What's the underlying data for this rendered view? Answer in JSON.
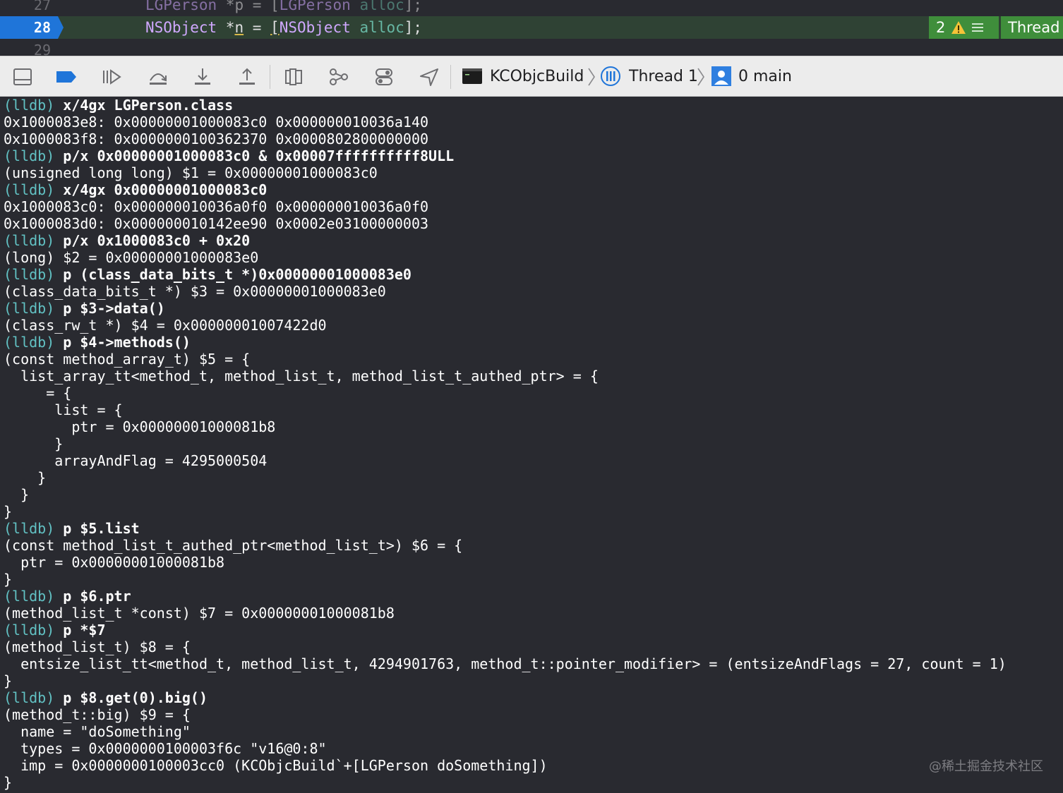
{
  "editor": {
    "lines": [
      {
        "number": "27",
        "code": "LGPerson *p = [LGPerson alloc];"
      },
      {
        "number": "28",
        "code": "NSObject *n = [NSObject alloc];"
      },
      {
        "number": "29",
        "code": ""
      }
    ],
    "issue_count": "2",
    "thread_tag": "Thread"
  },
  "debug_bar": {
    "buttons": [
      {
        "name": "hide-debug-area",
        "icon": "panel-bottom-icon"
      },
      {
        "name": "breakpoints-toggle",
        "icon": "breakpoint-icon",
        "color": "#1f75d9"
      },
      {
        "name": "continue",
        "icon": "continue-icon"
      },
      {
        "name": "step-over",
        "icon": "step-over-icon"
      },
      {
        "name": "step-into",
        "icon": "step-into-icon"
      },
      {
        "name": "step-out",
        "icon": "step-out-icon"
      },
      {
        "name": "debug-view-hierarchy",
        "icon": "view-hierarchy-icon"
      },
      {
        "name": "memory-graph",
        "icon": "memory-graph-icon"
      },
      {
        "name": "environment-overrides",
        "icon": "toggles-icon"
      },
      {
        "name": "simulate-location",
        "icon": "location-arrow-icon"
      }
    ],
    "breadcrumb": {
      "target": "KCObjcBuild",
      "thread": "Thread 1",
      "frame": "0 main"
    }
  },
  "console": {
    "prompt": "(lldb)",
    "lines": [
      {
        "type": "cmd",
        "text": "x/4gx LGPerson.class"
      },
      {
        "type": "out",
        "text": "0x1000083e8: 0x00000001000083c0 0x000000010036a140"
      },
      {
        "type": "out",
        "text": "0x1000083f8: 0x0000000100362370 0x0000802800000000"
      },
      {
        "type": "cmd",
        "text": "p/x 0x00000001000083c0 & 0x00007ffffffffff8ULL"
      },
      {
        "type": "out",
        "text": "(unsigned long long) $1 = 0x00000001000083c0"
      },
      {
        "type": "cmd",
        "text": "x/4gx 0x00000001000083c0"
      },
      {
        "type": "out",
        "text": "0x1000083c0: 0x000000010036a0f0 0x000000010036a0f0"
      },
      {
        "type": "out",
        "text": "0x1000083d0: 0x000000010142ee90 0x0002e03100000003"
      },
      {
        "type": "cmd",
        "text": "p/x 0x1000083c0 + 0x20"
      },
      {
        "type": "out",
        "text": "(long) $2 = 0x00000001000083e0"
      },
      {
        "type": "cmd",
        "text": "p (class_data_bits_t *)0x00000001000083e0"
      },
      {
        "type": "out",
        "text": "(class_data_bits_t *) $3 = 0x00000001000083e0"
      },
      {
        "type": "cmd",
        "text": "p $3->data()"
      },
      {
        "type": "out",
        "text": "(class_rw_t *) $4 = 0x00000001007422d0"
      },
      {
        "type": "cmd",
        "text": "p $4->methods()"
      },
      {
        "type": "out",
        "text": "(const method_array_t) $5 = {"
      },
      {
        "type": "out",
        "text": "  list_array_tt<method_t, method_list_t, method_list_t_authed_ptr> = {"
      },
      {
        "type": "out",
        "text": "     = {"
      },
      {
        "type": "out",
        "text": "      list = {"
      },
      {
        "type": "out",
        "text": "        ptr = 0x00000001000081b8"
      },
      {
        "type": "out",
        "text": "      }"
      },
      {
        "type": "out",
        "text": "      arrayAndFlag = 4295000504"
      },
      {
        "type": "out",
        "text": "    }"
      },
      {
        "type": "out",
        "text": "  }"
      },
      {
        "type": "out",
        "text": "}"
      },
      {
        "type": "cmd",
        "text": "p $5.list"
      },
      {
        "type": "out",
        "text": "(const method_list_t_authed_ptr<method_list_t>) $6 = {"
      },
      {
        "type": "out",
        "text": "  ptr = 0x00000001000081b8"
      },
      {
        "type": "out",
        "text": "}"
      },
      {
        "type": "cmd",
        "text": "p $6.ptr"
      },
      {
        "type": "out",
        "text": "(method_list_t *const) $7 = 0x00000001000081b8"
      },
      {
        "type": "cmd",
        "text": "p *$7"
      },
      {
        "type": "out",
        "text": "(method_list_t) $8 = {"
      },
      {
        "type": "out",
        "text": "  entsize_list_tt<method_t, method_list_t, 4294901763, method_t::pointer_modifier> = (entsizeAndFlags = 27, count = 1)"
      },
      {
        "type": "out",
        "text": "}"
      },
      {
        "type": "cmd",
        "text": "p $8.get(0).big()"
      },
      {
        "type": "out",
        "text": "(method_t::big) $9 = {"
      },
      {
        "type": "out",
        "text": "  name = \"doSomething\""
      },
      {
        "type": "out",
        "text": "  types = 0x0000000100003f6c \"v16@0:8\""
      },
      {
        "type": "out",
        "text": "  imp = 0x0000000100003cc0 (KCObjcBuild`+[LGPerson doSomething])"
      },
      {
        "type": "out",
        "text": "}"
      }
    ]
  },
  "watermark": "@稀土掘金技术社区"
}
